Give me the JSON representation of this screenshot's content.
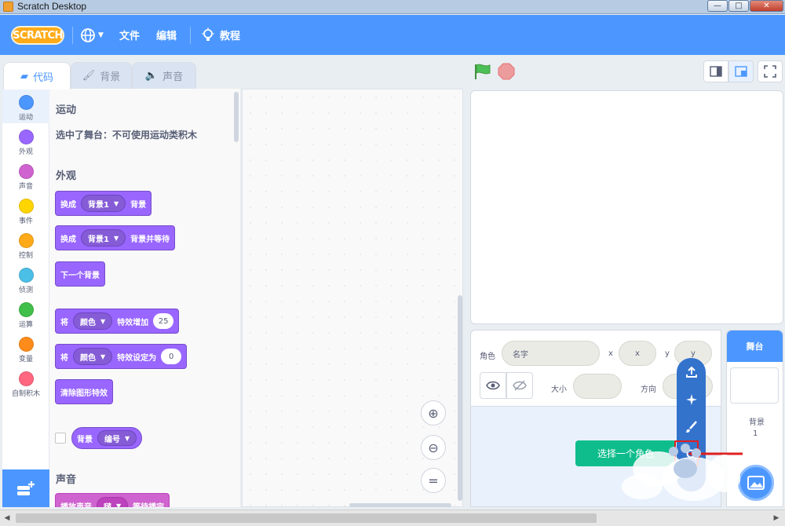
{
  "window": {
    "title": "Scratch Desktop"
  },
  "menubar": {
    "logo": "SCRATCH",
    "file": "文件",
    "edit": "编辑",
    "tutorials": "教程"
  },
  "tabs": {
    "code": "代码",
    "backdrops": "背景",
    "sounds": "声音"
  },
  "categories": [
    {
      "label": "运动",
      "color": "#4c97ff"
    },
    {
      "label": "外观",
      "color": "#9966ff"
    },
    {
      "label": "声音",
      "color": "#cf63cf"
    },
    {
      "label": "事件",
      "color": "#ffd500"
    },
    {
      "label": "控制",
      "color": "#ffab19"
    },
    {
      "label": "侦测",
      "color": "#4cbfe6"
    },
    {
      "label": "运算",
      "color": "#40bf4a"
    },
    {
      "label": "变量",
      "color": "#ff8c1a"
    },
    {
      "label": "自制积木",
      "color": "#ff6680"
    }
  ],
  "palette": {
    "motion_heading": "运动",
    "motion_note": "选中了舞台：不可使用运动类积木",
    "looks_heading": "外观",
    "b1_verb": "换成",
    "b1_dd": "背景1",
    "b1_tail": "背景",
    "b2_verb": "换成",
    "b2_dd": "背景1",
    "b2_tail": "背景并等待",
    "b3": "下一个背景",
    "b4_verb": "将",
    "b4_dd": "颜色",
    "b4_mid": "特效增加",
    "b4_num": "25",
    "b5_verb": "将",
    "b5_dd": "颜色",
    "b5_mid": "特效设定为",
    "b5_num": "0",
    "b6": "清除图形特效",
    "r1_label": "背景",
    "r1_dd": "编号",
    "sound_heading": "声音",
    "s1_label": "播放声音",
    "s1_dd": "啵",
    "s1_tail": "等待播完"
  },
  "sprite_info": {
    "sprite_label": "角色",
    "name_placeholder": "名字",
    "x_label": "x",
    "x_value": "x",
    "y_label": "y",
    "y_value": "y",
    "size_label": "大小",
    "direction_label": "方向"
  },
  "stage_pane": {
    "title": "舞台",
    "backdrops_label": "背景",
    "backdrops_count": "1"
  },
  "sprite_chooser": {
    "choose_label": "选择一个角色"
  }
}
